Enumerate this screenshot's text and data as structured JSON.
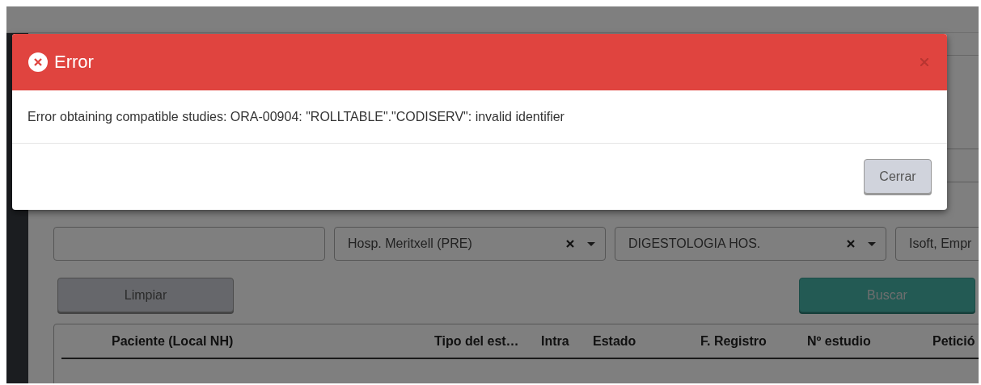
{
  "modal": {
    "title": "Error",
    "message": "Error obtaining compatible studies: ORA-00904: \"ROLLTABLE\".\"CODISERV\": invalid identifier",
    "buttons": [
      {
        "label": "Cerrar"
      }
    ]
  },
  "filters": [
    {
      "kind": "text"
    },
    {
      "kind": "select",
      "value": "Hosp. Meritxell (PRE)"
    },
    {
      "kind": "select",
      "value": "DIGESTOLOGIA HOS."
    },
    {
      "kind": "text",
      "value": "Isoft, Empr"
    }
  ],
  "actions": [
    {
      "label": "Limpiar",
      "kind": "secondary"
    },
    {
      "label": "Buscar",
      "kind": "primary"
    }
  ],
  "table": {
    "columns": [
      "Paciente (Local NH)",
      "Tipo del est…",
      "Intra",
      "Estado",
      "F. Registro",
      "Nº estudio",
      "Petició"
    ]
  }
}
